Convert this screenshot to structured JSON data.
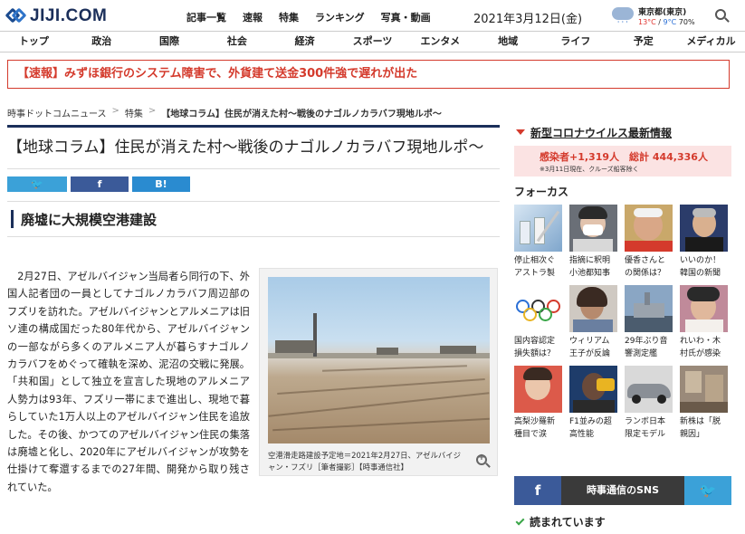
{
  "header": {
    "logo_text": "JIJI.COM",
    "nav": [
      "記事一覧",
      "速報",
      "特集",
      "ランキング",
      "写真・動画"
    ],
    "date": "2021年3月12日(金)",
    "weather": {
      "city": "東京都(東京)",
      "high": "13°C",
      "low": "9°C",
      "rain": "70%"
    }
  },
  "categories": [
    "トップ",
    "政治",
    "国際",
    "社会",
    "経済",
    "スポーツ",
    "エンタメ",
    "地域",
    "ライフ",
    "予定",
    "メディカル"
  ],
  "breaking": "【速報】みずほ銀行のシステム障害で、外貨建て送金300件強で遅れが出た",
  "breadcrumb": [
    "時事ドットコムニュース",
    "特集",
    "【地球コラム】住民が消えた村～戦後のナゴルノカラバフ現地ルポ～"
  ],
  "article": {
    "title": "【地球コラム】住民が消えた村～戦後のナゴルノカラバフ現地ルポ～",
    "share": {
      "twitter": "🐦",
      "facebook": "f",
      "hatena": "B!"
    },
    "section": "廃墟に大規模空港建設",
    "body": "2月27日、アゼルバイジャン当局者ら同行の下、外国人記者団の一員としてナゴルノカラバフ周辺部のフズリを訪れた。アゼルバイジャンとアルメニアは旧ソ連の構成国だった80年代から、アゼルバイジャンの一部ながら多くのアルメニア人が暮らすナゴルノカラバフをめぐって確執を深め、泥沼の交戦に発展。「共和国」として独立を宣言した現地のアルメニア人勢力は93年、フズリ一帯にまで進出し、現地で暮らしていた1万人以上のアゼルバイジャン住民を追放した。その後、かつてのアゼルバイジャン住民の集落は廃墟と化し、2020年にアゼルバイジャンが攻勢を仕掛けて奪還するまでの27年間、開発から取り残されていた。",
    "photo_caption": "空港滑走路建設予定地＝2021年2月27日、アゼルバイジャン・フズリ［筆者撮影］【時事通信社】"
  },
  "sidebar": {
    "covid_title": "新型コロナウイルス最新情報",
    "covid_stats": "感染者+1,319人　総計 444,336人",
    "covid_note": "※3月11日現在、クルーズ船客除く",
    "focus_title": "フォーカス",
    "focus_items": [
      "停止相次ぐアストラ製",
      "指摘に釈明小池都知事",
      "優香さんとの関係は？",
      "いいのか！韓国の新聞",
      "国内容認定損失額は？",
      "ウィリアム王子が反論",
      "29年ぶり音響測定艦",
      "れいわ・木村氏が感染",
      "高梨沙羅新種目で涙",
      "F1並みの超高性能",
      "ランボ日本限定モデル",
      "新株は「脱親因」"
    ],
    "sns_facebook": "f",
    "sns_label": "時事通信のSNS",
    "sns_twitter": "🐦",
    "read_title": "読まれています"
  },
  "colors": {
    "brand": "#1b2f5a",
    "breaking": "#d43a2c",
    "facebook": "#3b5a99",
    "twitter": "#3ba1d8"
  }
}
